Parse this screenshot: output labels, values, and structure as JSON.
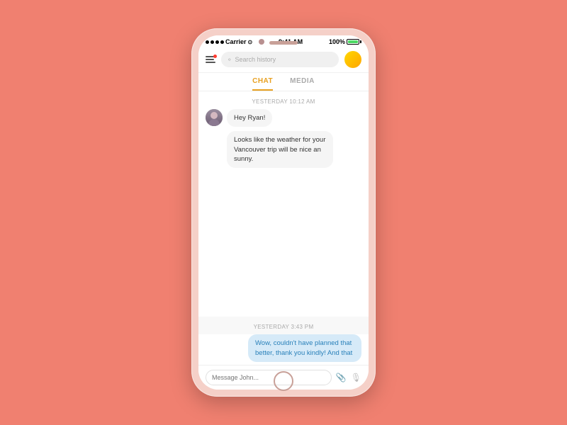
{
  "background": "#F08070",
  "phone": {
    "statusBar": {
      "carrier": "Carrier",
      "wifi": true,
      "time": "9:41 AM",
      "battery": "100%"
    },
    "header": {
      "searchPlaceholder": "Search history",
      "hamburgerLabel": "Menu"
    },
    "tabs": [
      {
        "label": "CHAT",
        "active": true
      },
      {
        "label": "MEDIA",
        "active": false
      }
    ],
    "chat": {
      "dateSeparator1": "YESTERDAY  10:12 AM",
      "messages": [
        {
          "text": "Hey Ryan!",
          "type": "incoming"
        },
        {
          "text": "Looks like the weather for your Vancouver trip will be nice an sunny.",
          "type": "incoming"
        }
      ],
      "dateSeparator2": "YESTERDAY  3:43 PM",
      "outgoing": {
        "text": "Wow, couldn't have planned that better, thank you kindly! And that"
      }
    },
    "inputBar": {
      "placeholder": "Message John..."
    }
  }
}
